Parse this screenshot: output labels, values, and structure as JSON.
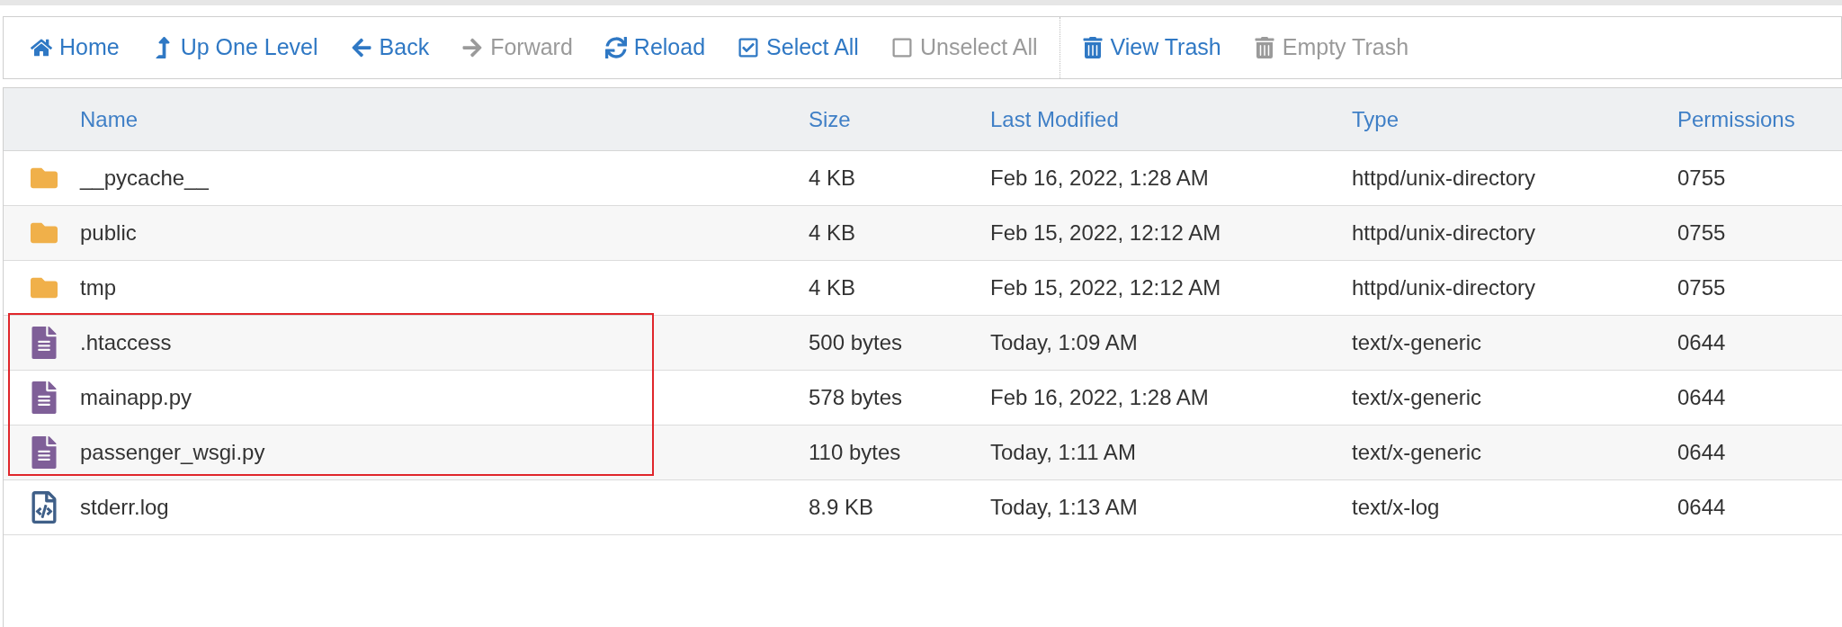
{
  "toolbar": [
    {
      "kind": "home",
      "label": "Home",
      "disabled": false,
      "separator_before": false
    },
    {
      "kind": "up",
      "label": "Up One Level",
      "disabled": false,
      "separator_before": false
    },
    {
      "kind": "back",
      "label": "Back",
      "disabled": false,
      "separator_before": false
    },
    {
      "kind": "forward",
      "label": "Forward",
      "disabled": true,
      "separator_before": false
    },
    {
      "kind": "reload",
      "label": "Reload",
      "disabled": false,
      "separator_before": false
    },
    {
      "kind": "select",
      "label": "Select All",
      "disabled": false,
      "separator_before": false
    },
    {
      "kind": "unselect",
      "label": "Unselect All",
      "disabled": true,
      "separator_before": false
    },
    {
      "kind": "trash",
      "label": "View Trash",
      "disabled": false,
      "separator_before": true
    },
    {
      "kind": "trash",
      "label": "Empty Trash",
      "disabled": true,
      "separator_before": false
    }
  ],
  "table": {
    "columns": [
      "Name",
      "Size",
      "Last Modified",
      "Type",
      "Permissions"
    ],
    "rows": [
      {
        "kind": "folder",
        "name": "__pycache__",
        "size": "4 KB",
        "modified": "Feb 16, 2022, 1:28 AM",
        "type": "httpd/unix-directory",
        "permissions": "0755",
        "highlighted": false
      },
      {
        "kind": "folder",
        "name": "public",
        "size": "4 KB",
        "modified": "Feb 15, 2022, 12:12 AM",
        "type": "httpd/unix-directory",
        "permissions": "0755",
        "highlighted": false
      },
      {
        "kind": "folder",
        "name": "tmp",
        "size": "4 KB",
        "modified": "Feb 15, 2022, 12:12 AM",
        "type": "httpd/unix-directory",
        "permissions": "0755",
        "highlighted": false
      },
      {
        "kind": "text",
        "name": ".htaccess",
        "size": "500 bytes",
        "modified": "Today, 1:09 AM",
        "type": "text/x-generic",
        "permissions": "0644",
        "highlighted": true
      },
      {
        "kind": "text",
        "name": "mainapp.py",
        "size": "578 bytes",
        "modified": "Feb 16, 2022, 1:28 AM",
        "type": "text/x-generic",
        "permissions": "0644",
        "highlighted": true
      },
      {
        "kind": "text",
        "name": "passenger_wsgi.py",
        "size": "110 bytes",
        "modified": "Today, 1:11 AM",
        "type": "text/x-generic",
        "permissions": "0644",
        "highlighted": true
      },
      {
        "kind": "code",
        "name": "stderr.log",
        "size": "8.9 KB",
        "modified": "Today, 1:13 AM",
        "type": "text/x-log",
        "permissions": "0644",
        "highlighted": false
      }
    ]
  }
}
